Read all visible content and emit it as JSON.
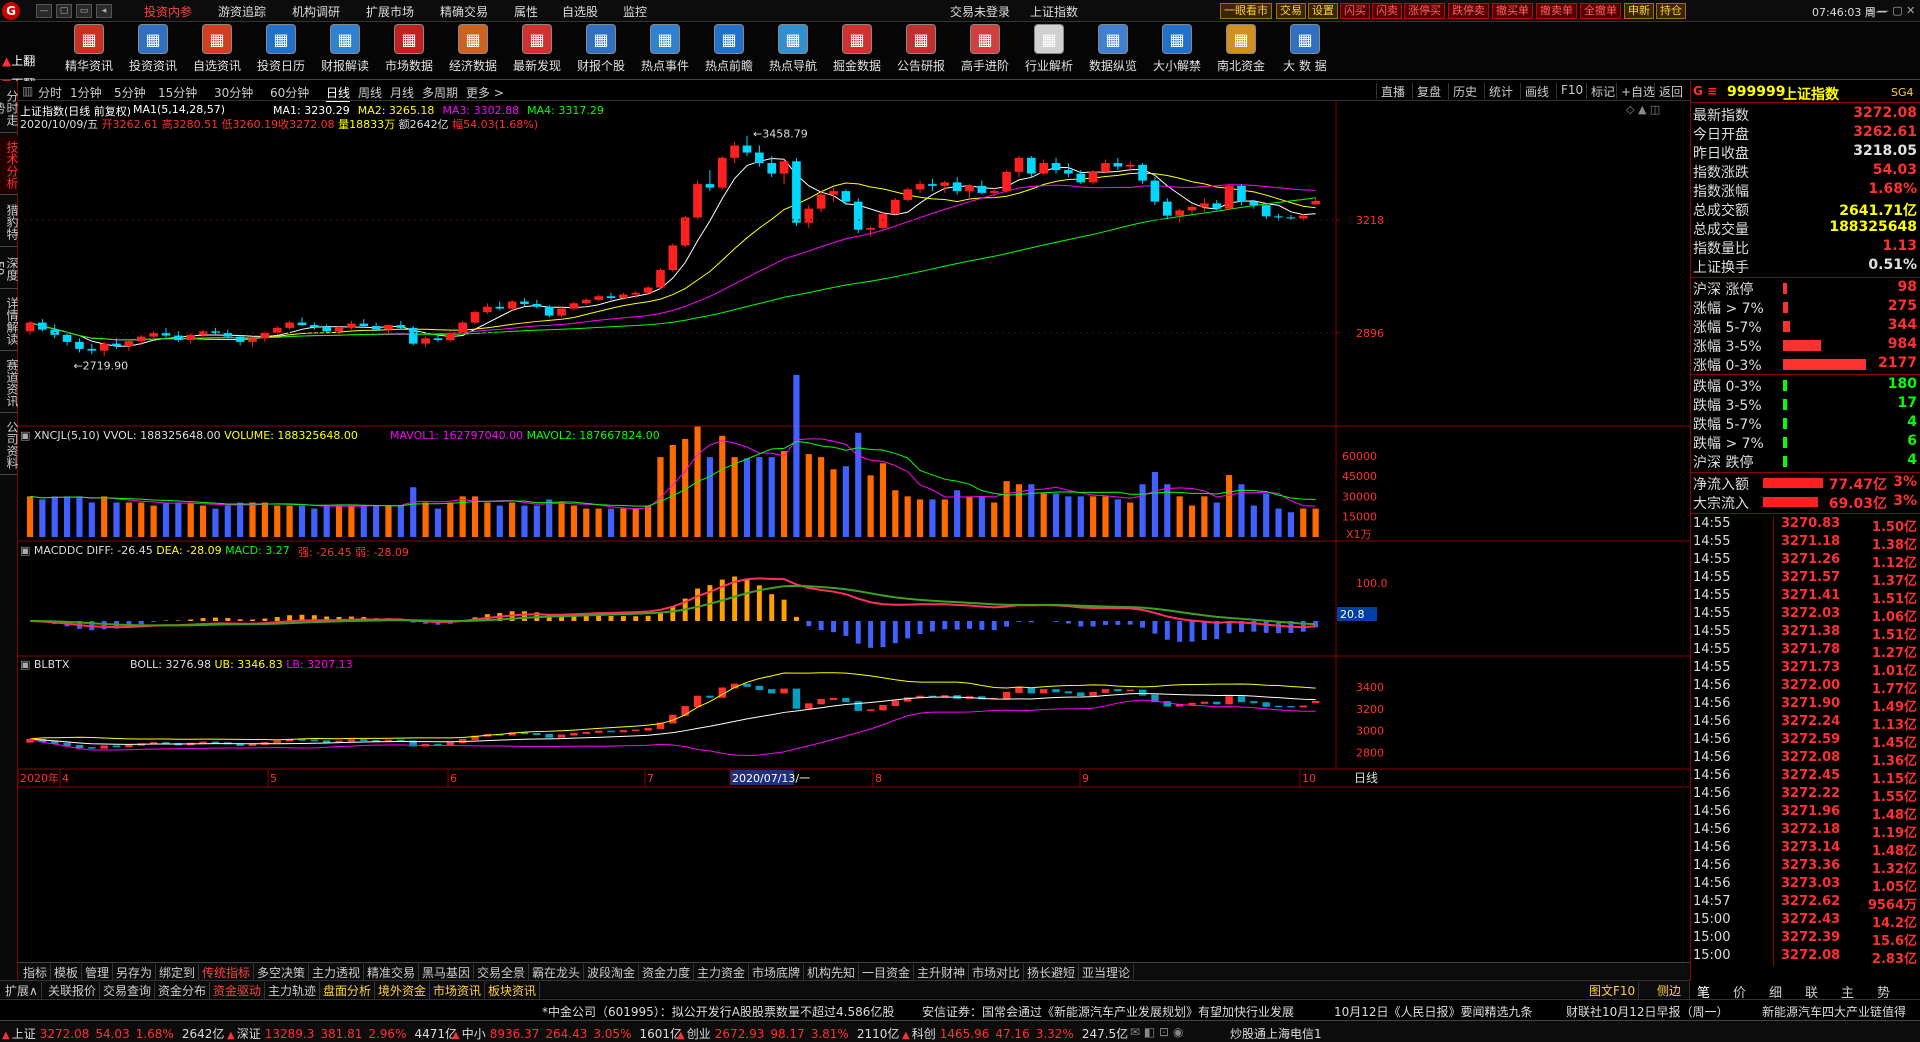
{
  "menubar": {
    "items": [
      "投资内参",
      "游资追踪",
      "机构调研",
      "扩展市场",
      "精确交易",
      "属性",
      "自选股",
      "监控"
    ],
    "center": [
      "交易未登录",
      "上证指数"
    ],
    "quick": [
      "一眼看市",
      "交易",
      "设置",
      "闪买",
      "闪卖",
      "涨停买",
      "跌停卖",
      "撤买单",
      "撤卖单",
      "全撤单",
      "申新",
      "持仓"
    ],
    "clock": "07:46:03 周一"
  },
  "toolbar": {
    "up": "上翻",
    "down": "下翻",
    "items": [
      {
        "label": "精华资讯",
        "icon": "report-icon",
        "color": "#c83020"
      },
      {
        "label": "投资资讯",
        "icon": "chart-icon",
        "color": "#3070c0"
      },
      {
        "label": "自选资讯",
        "icon": "bar-icon",
        "color": "#d04020"
      },
      {
        "label": "投资日历",
        "icon": "calendar-icon",
        "color": "#2070d0"
      },
      {
        "label": "财报解读",
        "icon": "magnifier-icon",
        "color": "#3080d0"
      },
      {
        "label": "市场数据",
        "icon": "news-icon",
        "color": "#c02020"
      },
      {
        "label": "经济数据",
        "icon": "stack-icon",
        "color": "#d06020"
      },
      {
        "label": "最新发现",
        "icon": "wave-icon",
        "color": "#d03030"
      },
      {
        "label": "财报个股",
        "icon": "doc-icon",
        "color": "#3070c0"
      },
      {
        "label": "热点事件",
        "icon": "check-icon",
        "color": "#3080d0"
      },
      {
        "label": "热点前瞻",
        "icon": "day-icon",
        "color": "#2070d0"
      },
      {
        "label": "热点导航",
        "icon": "globe-icon",
        "color": "#3090d0"
      },
      {
        "label": "掘金数据",
        "icon": "calendar10-icon",
        "color": "#d03030"
      },
      {
        "label": "公告研报",
        "icon": "doc-icon",
        "color": "#c03030"
      },
      {
        "label": "高手进阶",
        "icon": "trend-icon",
        "color": "#d04040"
      },
      {
        "label": "行业解析",
        "icon": "board-icon",
        "color": "#d0d0d0"
      },
      {
        "label": "数据纵览",
        "icon": "data-icon",
        "color": "#4080d0"
      },
      {
        "label": "大小解禁",
        "icon": "calendar31-icon",
        "color": "#2070d0"
      },
      {
        "label": "南北资金",
        "icon": "bulb-icon",
        "color": "#d09020"
      },
      {
        "label": "大 数 据",
        "icon": "clapper-icon",
        "color": "#3070c0"
      }
    ]
  },
  "periodbar": {
    "periods": [
      "分时",
      "1分钟",
      "5分钟",
      "15分钟",
      "30分钟",
      "60分钟",
      "日线",
      "周线",
      "月线",
      "多周期",
      "更多 >"
    ],
    "active": "日线",
    "functions": [
      "直播",
      "复盘",
      "历史",
      "统计",
      "画线",
      "F10",
      "标记",
      "+自选",
      "返回"
    ]
  },
  "leftstrip": {
    "tabs": [
      "分时走势",
      "技术分析",
      "猎豹特",
      "深度F9",
      "详情解读",
      "赛道资讯",
      "公司资料"
    ],
    "active": "技术分析"
  },
  "chart_data": {
    "type": "candlestick",
    "title": "上证指数(日线 前复权)",
    "info": {
      "date": "2020/10/09/五",
      "open": "开3262.61",
      "high": "高3280.51",
      "low": "低3260.19",
      "close": "收3272.08",
      "volume": "量18833万",
      "amount": "额2642亿",
      "change": "幅54.03(1.68%)"
    },
    "ma_params": "MA1(5,14,28,57)",
    "ma_values": [
      {
        "label": "MA1: 3230.29",
        "color": "#ffffff"
      },
      {
        "label": "MA2: 3265.18",
        "color": "#ffff00"
      },
      {
        "label": "MA3: 3302.88",
        "color": "#ff00ff"
      },
      {
        "label": "MA4: 3317.29",
        "color": "#00ff00"
      }
    ],
    "annotations": [
      "3458.79",
      "2719.90"
    ],
    "yticks_main": [
      3218,
      2896
    ],
    "ylim_main": [
      2650,
      3500
    ],
    "candles_ohlc": [
      [
        2900,
        2930,
        2890,
        2925
      ],
      [
        2925,
        2935,
        2900,
        2905
      ],
      [
        2905,
        2920,
        2880,
        2890
      ],
      [
        2890,
        2900,
        2860,
        2870
      ],
      [
        2870,
        2880,
        2840,
        2850
      ],
      [
        2850,
        2865,
        2835,
        2845
      ],
      [
        2845,
        2870,
        2830,
        2865
      ],
      [
        2865,
        2880,
        2850,
        2858
      ],
      [
        2858,
        2875,
        2845,
        2872
      ],
      [
        2872,
        2890,
        2860,
        2885
      ],
      [
        2885,
        2900,
        2875,
        2895
      ],
      [
        2895,
        2910,
        2880,
        2888
      ],
      [
        2888,
        2900,
        2870,
        2875
      ],
      [
        2875,
        2895,
        2865,
        2890
      ],
      [
        2890,
        2905,
        2880,
        2900
      ],
      [
        2900,
        2910,
        2890,
        2895
      ],
      [
        2895,
        2905,
        2880,
        2885
      ],
      [
        2885,
        2890,
        2860,
        2870
      ],
      [
        2870,
        2885,
        2855,
        2880
      ],
      [
        2880,
        2900,
        2870,
        2896
      ],
      [
        2896,
        2915,
        2890,
        2910
      ],
      [
        2910,
        2930,
        2905,
        2925
      ],
      [
        2925,
        2940,
        2915,
        2918
      ],
      [
        2918,
        2925,
        2905,
        2912
      ],
      [
        2912,
        2920,
        2895,
        2900
      ],
      [
        2900,
        2915,
        2890,
        2910
      ],
      [
        2910,
        2930,
        2905,
        2922
      ],
      [
        2922,
        2935,
        2910,
        2915
      ],
      [
        2915,
        2925,
        2900,
        2905
      ],
      [
        2905,
        2920,
        2895,
        2918
      ],
      [
        2918,
        2930,
        2905,
        2910
      ],
      [
        2910,
        2915,
        2860,
        2865
      ],
      [
        2865,
        2885,
        2855,
        2880
      ],
      [
        2880,
        2890,
        2870,
        2875
      ],
      [
        2875,
        2900,
        2870,
        2895
      ],
      [
        2895,
        2930,
        2890,
        2925
      ],
      [
        2925,
        2960,
        2920,
        2955
      ],
      [
        2955,
        2980,
        2950,
        2970
      ],
      [
        2970,
        2985,
        2960,
        2965
      ],
      [
        2965,
        2990,
        2960,
        2985
      ],
      [
        2985,
        2995,
        2970,
        2978
      ],
      [
        2978,
        2990,
        2965,
        2970
      ],
      [
        2970,
        2975,
        2940,
        2945
      ],
      [
        2945,
        2970,
        2940,
        2965
      ],
      [
        2965,
        2985,
        2960,
        2980
      ],
      [
        2980,
        2995,
        2975,
        2990
      ],
      [
        2990,
        3005,
        2985,
        3000
      ],
      [
        3000,
        3010,
        2990,
        2995
      ],
      [
        2995,
        3010,
        2990,
        3005
      ],
      [
        3005,
        3015,
        2995,
        3010
      ],
      [
        3010,
        3030,
        3005,
        3025
      ],
      [
        3025,
        3080,
        3020,
        3075
      ],
      [
        3075,
        3150,
        3070,
        3145
      ],
      [
        3145,
        3230,
        3140,
        3225
      ],
      [
        3225,
        3330,
        3220,
        3320
      ],
      [
        3320,
        3360,
        3300,
        3310
      ],
      [
        3310,
        3400,
        3305,
        3395
      ],
      [
        3395,
        3440,
        3380,
        3430
      ],
      [
        3430,
        3458,
        3400,
        3410
      ],
      [
        3410,
        3430,
        3370,
        3380
      ],
      [
        3380,
        3400,
        3340,
        3350
      ],
      [
        3350,
        3390,
        3320,
        3385
      ],
      [
        3385,
        3395,
        3200,
        3210
      ],
      [
        3210,
        3260,
        3195,
        3250
      ],
      [
        3250,
        3300,
        3240,
        3290
      ],
      [
        3290,
        3310,
        3270,
        3300
      ],
      [
        3300,
        3305,
        3260,
        3270
      ],
      [
        3270,
        3280,
        3180,
        3190
      ],
      [
        3190,
        3200,
        3170,
        3195
      ],
      [
        3195,
        3240,
        3190,
        3235
      ],
      [
        3235,
        3280,
        3230,
        3275
      ],
      [
        3275,
        3310,
        3270,
        3305
      ],
      [
        3305,
        3330,
        3295,
        3320
      ],
      [
        3320,
        3335,
        3300,
        3315
      ],
      [
        3315,
        3330,
        3295,
        3325
      ],
      [
        3325,
        3340,
        3290,
        3300
      ],
      [
        3300,
        3320,
        3280,
        3315
      ],
      [
        3315,
        3330,
        3290,
        3295
      ],
      [
        3295,
        3310,
        3280,
        3300
      ],
      [
        3300,
        3360,
        3295,
        3355
      ],
      [
        3355,
        3400,
        3340,
        3395
      ],
      [
        3395,
        3400,
        3340,
        3350
      ],
      [
        3350,
        3390,
        3345,
        3380
      ],
      [
        3380,
        3395,
        3350,
        3360
      ],
      [
        3360,
        3380,
        3340,
        3350
      ],
      [
        3350,
        3360,
        3320,
        3325
      ],
      [
        3325,
        3360,
        3320,
        3355
      ],
      [
        3355,
        3390,
        3350,
        3380
      ],
      [
        3380,
        3395,
        3360,
        3370
      ],
      [
        3370,
        3385,
        3355,
        3375
      ],
      [
        3375,
        3380,
        3320,
        3330
      ],
      [
        3330,
        3340,
        3260,
        3270
      ],
      [
        3270,
        3280,
        3220,
        3230
      ],
      [
        3230,
        3250,
        3210,
        3245
      ],
      [
        3245,
        3260,
        3235,
        3255
      ],
      [
        3255,
        3280,
        3240,
        3265
      ],
      [
        3265,
        3275,
        3245,
        3250
      ],
      [
        3250,
        3320,
        3245,
        3315
      ],
      [
        3315,
        3320,
        3260,
        3270
      ],
      [
        3270,
        3275,
        3250,
        3260
      ],
      [
        3260,
        3265,
        3220,
        3228
      ],
      [
        3228,
        3235,
        3215,
        3225
      ],
      [
        3225,
        3232,
        3218,
        3222
      ],
      [
        3222,
        3235,
        3215,
        3230
      ],
      [
        3262,
        3280,
        3260,
        3272
      ]
    ],
    "volume_indicator": {
      "label": "XNCJL(5,10)",
      "vvol": "VVOL: 188325648.00",
      "volume": "VOLUME: 188325648.00",
      "mavol1": "MAVOL1: 162797040.00",
      "mavol2": "MAVOL2: 187667824.00",
      "yticks": [
        60000,
        45000,
        30000,
        15000
      ],
      "unit": "X1万"
    },
    "macd_indicator": {
      "label": "MACDDC",
      "diff": "DIFF: -26.45",
      "dea": "DEA: -28.09",
      "macd": "MACD: 3.27",
      "extra1": "强: -26.45",
      "extra2": "弱: -28.09",
      "ytick": "100.0",
      "current": "20.8"
    },
    "boll_indicator": {
      "label": "BLBTX",
      "boll": "BOLL: 3276.98",
      "ub": "UB: 3346.83",
      "lb": "LB: 3207.13",
      "yticks": [
        3400,
        3200,
        3000,
        2800
      ]
    },
    "xlabels": [
      "2020年",
      "4",
      "5",
      "6",
      "7",
      "2020/07/13/一",
      "8",
      "9",
      "10"
    ],
    "xlabel_right": "日线"
  },
  "rightpanel": {
    "code": "999999",
    "name": "上证指数",
    "tag": "SG4",
    "rows": [
      {
        "k": "最新指数",
        "v": "3272.08",
        "c": "#ff3030"
      },
      {
        "k": "今日开盘",
        "v": "3262.61",
        "c": "#ff3030"
      },
      {
        "k": "昨日收盘",
        "v": "3218.05",
        "c": "#e0e0e0"
      },
      {
        "k": "指数涨跌",
        "v": "54.03",
        "c": "#ff3030"
      },
      {
        "k": "指数涨幅",
        "v": "1.68%",
        "c": "#ff3030"
      },
      {
        "k": "总成交额",
        "v": "2641.71亿",
        "c": "#ffff00"
      },
      {
        "k": "总成交量",
        "v": "188325648",
        "c": "#ffff00"
      },
      {
        "k": "指数量比",
        "v": "1.13",
        "c": "#ff3030"
      },
      {
        "k": "上证换手",
        "v": "0.51%",
        "c": "#e0e0e0"
      }
    ],
    "dist": [
      {
        "k": "沪深 涨停",
        "v": "98",
        "c": "#ff3030",
        "w": 0.02
      },
      {
        "k": "涨幅 > 7%",
        "v": "275",
        "c": "#ff3030",
        "w": 0.06
      },
      {
        "k": "涨幅 5-7%",
        "v": "344",
        "c": "#ff3030",
        "w": 0.08
      },
      {
        "k": "涨幅 3-5%",
        "v": "984",
        "c": "#ff3030",
        "w": 0.45
      },
      {
        "k": "涨幅 0-3%",
        "v": "2177",
        "c": "#ff3030",
        "w": 0.98
      },
      {
        "k": "跌幅 0-3%",
        "v": "180",
        "c": "#00ff00",
        "w": 0.02
      },
      {
        "k": "跌幅 3-5%",
        "v": "17",
        "c": "#00ff00",
        "w": 0.01
      },
      {
        "k": "跌幅 5-7%",
        "v": "4",
        "c": "#00ff00",
        "w": 0.01
      },
      {
        "k": "跌幅 > 7%",
        "v": "6",
        "c": "#00ff00",
        "w": 0.01
      },
      {
        "k": "沪深 跌停",
        "v": "4",
        "c": "#00ff00",
        "w": 0.01
      }
    ],
    "flows": [
      {
        "k": "净流入额",
        "v": "77.47亿",
        "p": "3%",
        "w": 0.85
      },
      {
        "k": "大宗流入",
        "v": "69.03亿",
        "p": "3%",
        "w": 0.78
      }
    ],
    "ticks": [
      [
        "14:55",
        "3270.83",
        "1.50亿"
      ],
      [
        "14:55",
        "3271.18",
        "1.38亿"
      ],
      [
        "14:55",
        "3271.26",
        "1.12亿"
      ],
      [
        "14:55",
        "3271.57",
        "1.37亿"
      ],
      [
        "14:55",
        "3271.41",
        "1.51亿"
      ],
      [
        "14:55",
        "3272.03",
        "1.06亿"
      ],
      [
        "14:55",
        "3271.38",
        "1.51亿"
      ],
      [
        "14:55",
        "3271.78",
        "1.27亿"
      ],
      [
        "14:55",
        "3271.73",
        "1.01亿"
      ],
      [
        "14:56",
        "3272.00",
        "1.77亿"
      ],
      [
        "14:56",
        "3271.90",
        "1.49亿"
      ],
      [
        "14:56",
        "3272.24",
        "1.13亿"
      ],
      [
        "14:56",
        "3272.59",
        "1.45亿"
      ],
      [
        "14:56",
        "3272.08",
        "1.36亿"
      ],
      [
        "14:56",
        "3272.45",
        "1.15亿"
      ],
      [
        "14:56",
        "3272.22",
        "1.55亿"
      ],
      [
        "14:56",
        "3271.96",
        "1.48亿"
      ],
      [
        "14:56",
        "3272.18",
        "1.19亿"
      ],
      [
        "14:56",
        "3273.14",
        "1.48亿"
      ],
      [
        "14:56",
        "3273.36",
        "1.32亿"
      ],
      [
        "14:56",
        "3273.03",
        "1.05亿"
      ],
      [
        "14:57",
        "3272.62",
        "9564万"
      ],
      [
        "15:00",
        "3272.43",
        "14.2亿"
      ],
      [
        "15:00",
        "3272.39",
        "15.6亿"
      ],
      [
        "15:00",
        "3272.08",
        "2.83亿"
      ]
    ],
    "bottomtabs": [
      "笔",
      "价",
      "细",
      "联",
      "主",
      "势"
    ]
  },
  "indtabs": {
    "row1": [
      "指标",
      "模板",
      "管理",
      "另存为",
      "绑定到",
      "传统指标",
      "多空决策",
      "主力透视",
      "精准交易",
      "黑马基因",
      "交易全景",
      "霸在龙头",
      "波段淘金",
      "资金力度",
      "主力资金",
      "市场底牌",
      "机构先知",
      "一目资金",
      "主升财神",
      "市场对比",
      "扬长避短",
      "亚当理论"
    ],
    "row1_active": "传统指标",
    "row2": [
      "扩展∧",
      "关联报价",
      "交易查询",
      "资金分布",
      "资金驱动",
      "主力轨迹",
      "盘面分析",
      "境外资金",
      "市场资讯",
      "板块资讯"
    ],
    "row2_right": [
      "图文F10",
      "侧边栏"
    ]
  },
  "news": [
    "*中金公司（601995）：拟公开发行A股股票数量不超过4.586亿股",
    "安信证券：国常会通过《新能源汽车产业发展规划》有望加快行业发展",
    "10月12日《人民日报》要闻精选九条",
    "财联社10月12日早报（周一）",
    "新能源汽车四大产业链值得"
  ],
  "statusbar": [
    {
      "name": "上证",
      "val": "3272.08",
      "chg": "54.03",
      "pct": "1.68%",
      "amt": "2642亿"
    },
    {
      "name": "深证",
      "val": "13289.3",
      "chg": "381.81",
      "pct": "2.96%",
      "amt": "4471亿"
    },
    {
      "name": "中小",
      "val": "8936.37",
      "chg": "264.43",
      "pct": "3.05%",
      "amt": "1601亿"
    },
    {
      "name": "创业",
      "val": "2672.93",
      "chg": "98.17",
      "pct": "3.81%",
      "amt": "2110亿"
    },
    {
      "name": "科创",
      "val": "1465.96",
      "chg": "47.16",
      "pct": "3.32%",
      "amt": "247.5亿"
    }
  ],
  "status_right": "炒股通上海电信1",
  "colors": {
    "up": "#ff2020",
    "down": "#00d8ff",
    "ma1": "#ffffff",
    "ma2": "#ffff00",
    "ma3": "#ff00ff",
    "ma4": "#00ff00"
  }
}
